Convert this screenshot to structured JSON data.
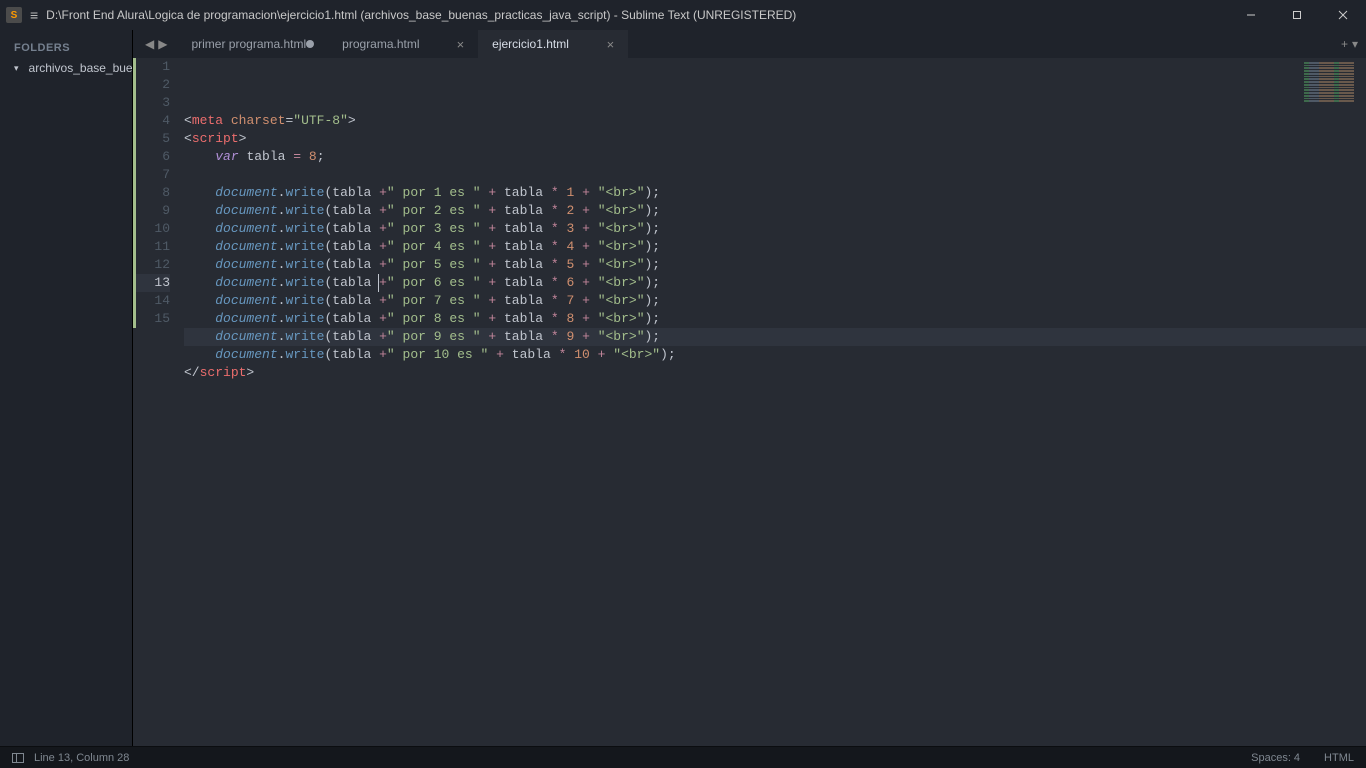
{
  "window": {
    "title": "D:\\Front End Alura\\Logica de programacion\\ejercicio1.html (archivos_base_buenas_practicas_java_script) - Sublime Text (UNREGISTERED)"
  },
  "sidebar": {
    "header": "FOLDERS",
    "root_folder": "archivos_base_buenas_practicas_java_script"
  },
  "tabs": [
    {
      "label": "primer programa.html",
      "dirty": true,
      "active": false
    },
    {
      "label": "programa.html",
      "dirty": false,
      "active": false
    },
    {
      "label": "ejercicio1.html",
      "dirty": false,
      "active": true
    }
  ],
  "editor": {
    "line_count": 15,
    "current_line": 13,
    "lines": [
      {
        "n": 1,
        "tokens": [
          [
            "p",
            "<"
          ],
          [
            "t",
            "meta"
          ],
          [
            "p",
            " "
          ],
          [
            "a",
            "charset"
          ],
          [
            "p",
            "="
          ],
          [
            "s",
            "\"UTF-8\""
          ],
          [
            "p",
            ">"
          ]
        ]
      },
      {
        "n": 2,
        "tokens": [
          [
            "p",
            "<"
          ],
          [
            "t",
            "script"
          ],
          [
            "p",
            ">"
          ]
        ]
      },
      {
        "n": 3,
        "tokens": [
          [
            "p",
            "    "
          ],
          [
            "k",
            "var"
          ],
          [
            "p",
            " "
          ],
          [
            "id",
            "tabla"
          ],
          [
            "p",
            " "
          ],
          [
            "op",
            "="
          ],
          [
            "p",
            " "
          ],
          [
            "n",
            "8"
          ],
          [
            "p",
            ";"
          ]
        ]
      },
      {
        "n": 4,
        "tokens": [
          [
            "p",
            ""
          ]
        ]
      },
      {
        "n": 5,
        "tokens": [
          [
            "p",
            "    "
          ],
          [
            "v",
            "document"
          ],
          [
            "p",
            "."
          ],
          [
            "f",
            "write"
          ],
          [
            "p",
            "("
          ],
          [
            "id",
            "tabla"
          ],
          [
            "p",
            " "
          ],
          [
            "op",
            "+"
          ],
          [
            "s",
            "\" por 1 es \""
          ],
          [
            "p",
            " "
          ],
          [
            "op",
            "+"
          ],
          [
            "p",
            " "
          ],
          [
            "id",
            "tabla"
          ],
          [
            "p",
            " "
          ],
          [
            "op",
            "*"
          ],
          [
            "p",
            " "
          ],
          [
            "n",
            "1"
          ],
          [
            "p",
            " "
          ],
          [
            "op",
            "+"
          ],
          [
            "p",
            " "
          ],
          [
            "s",
            "\"<br>\""
          ],
          [
            "p",
            ");"
          ]
        ]
      },
      {
        "n": 6,
        "tokens": [
          [
            "p",
            "    "
          ],
          [
            "v",
            "document"
          ],
          [
            "p",
            "."
          ],
          [
            "f",
            "write"
          ],
          [
            "p",
            "("
          ],
          [
            "id",
            "tabla"
          ],
          [
            "p",
            " "
          ],
          [
            "op",
            "+"
          ],
          [
            "s",
            "\" por 2 es \""
          ],
          [
            "p",
            " "
          ],
          [
            "op",
            "+"
          ],
          [
            "p",
            " "
          ],
          [
            "id",
            "tabla"
          ],
          [
            "p",
            " "
          ],
          [
            "op",
            "*"
          ],
          [
            "p",
            " "
          ],
          [
            "n",
            "2"
          ],
          [
            "p",
            " "
          ],
          [
            "op",
            "+"
          ],
          [
            "p",
            " "
          ],
          [
            "s",
            "\"<br>\""
          ],
          [
            "p",
            ");"
          ]
        ]
      },
      {
        "n": 7,
        "tokens": [
          [
            "p",
            "    "
          ],
          [
            "v",
            "document"
          ],
          [
            "p",
            "."
          ],
          [
            "f",
            "write"
          ],
          [
            "p",
            "("
          ],
          [
            "id",
            "tabla"
          ],
          [
            "p",
            " "
          ],
          [
            "op",
            "+"
          ],
          [
            "s",
            "\" por 3 es \""
          ],
          [
            "p",
            " "
          ],
          [
            "op",
            "+"
          ],
          [
            "p",
            " "
          ],
          [
            "id",
            "tabla"
          ],
          [
            "p",
            " "
          ],
          [
            "op",
            "*"
          ],
          [
            "p",
            " "
          ],
          [
            "n",
            "3"
          ],
          [
            "p",
            " "
          ],
          [
            "op",
            "+"
          ],
          [
            "p",
            " "
          ],
          [
            "s",
            "\"<br>\""
          ],
          [
            "p",
            ");"
          ]
        ]
      },
      {
        "n": 8,
        "tokens": [
          [
            "p",
            "    "
          ],
          [
            "v",
            "document"
          ],
          [
            "p",
            "."
          ],
          [
            "f",
            "write"
          ],
          [
            "p",
            "("
          ],
          [
            "id",
            "tabla"
          ],
          [
            "p",
            " "
          ],
          [
            "op",
            "+"
          ],
          [
            "s",
            "\" por 4 es \""
          ],
          [
            "p",
            " "
          ],
          [
            "op",
            "+"
          ],
          [
            "p",
            " "
          ],
          [
            "id",
            "tabla"
          ],
          [
            "p",
            " "
          ],
          [
            "op",
            "*"
          ],
          [
            "p",
            " "
          ],
          [
            "n",
            "4"
          ],
          [
            "p",
            " "
          ],
          [
            "op",
            "+"
          ],
          [
            "p",
            " "
          ],
          [
            "s",
            "\"<br>\""
          ],
          [
            "p",
            ");"
          ]
        ]
      },
      {
        "n": 9,
        "tokens": [
          [
            "p",
            "    "
          ],
          [
            "v",
            "document"
          ],
          [
            "p",
            "."
          ],
          [
            "f",
            "write"
          ],
          [
            "p",
            "("
          ],
          [
            "id",
            "tabla"
          ],
          [
            "p",
            " "
          ],
          [
            "op",
            "+"
          ],
          [
            "s",
            "\" por 5 es \""
          ],
          [
            "p",
            " "
          ],
          [
            "op",
            "+"
          ],
          [
            "p",
            " "
          ],
          [
            "id",
            "tabla"
          ],
          [
            "p",
            " "
          ],
          [
            "op",
            "*"
          ],
          [
            "p",
            " "
          ],
          [
            "n",
            "5"
          ],
          [
            "p",
            " "
          ],
          [
            "op",
            "+"
          ],
          [
            "p",
            " "
          ],
          [
            "s",
            "\"<br>\""
          ],
          [
            "p",
            ");"
          ]
        ]
      },
      {
        "n": 10,
        "tokens": [
          [
            "p",
            "    "
          ],
          [
            "v",
            "document"
          ],
          [
            "p",
            "."
          ],
          [
            "f",
            "write"
          ],
          [
            "p",
            "("
          ],
          [
            "id",
            "tabla"
          ],
          [
            "p",
            " "
          ],
          [
            "op",
            "+"
          ],
          [
            "s",
            "\" por 6 es \""
          ],
          [
            "p",
            " "
          ],
          [
            "op",
            "+"
          ],
          [
            "p",
            " "
          ],
          [
            "id",
            "tabla"
          ],
          [
            "p",
            " "
          ],
          [
            "op",
            "*"
          ],
          [
            "p",
            " "
          ],
          [
            "n",
            "6"
          ],
          [
            "p",
            " "
          ],
          [
            "op",
            "+"
          ],
          [
            "p",
            " "
          ],
          [
            "s",
            "\"<br>\""
          ],
          [
            "p",
            ");"
          ]
        ]
      },
      {
        "n": 11,
        "tokens": [
          [
            "p",
            "    "
          ],
          [
            "v",
            "document"
          ],
          [
            "p",
            "."
          ],
          [
            "f",
            "write"
          ],
          [
            "p",
            "("
          ],
          [
            "id",
            "tabla"
          ],
          [
            "p",
            " "
          ],
          [
            "op",
            "+"
          ],
          [
            "s",
            "\" por 7 es \""
          ],
          [
            "p",
            " "
          ],
          [
            "op",
            "+"
          ],
          [
            "p",
            " "
          ],
          [
            "id",
            "tabla"
          ],
          [
            "p",
            " "
          ],
          [
            "op",
            "*"
          ],
          [
            "p",
            " "
          ],
          [
            "n",
            "7"
          ],
          [
            "p",
            " "
          ],
          [
            "op",
            "+"
          ],
          [
            "p",
            " "
          ],
          [
            "s",
            "\"<br>\""
          ],
          [
            "p",
            ");"
          ]
        ]
      },
      {
        "n": 12,
        "tokens": [
          [
            "p",
            "    "
          ],
          [
            "v",
            "document"
          ],
          [
            "p",
            "."
          ],
          [
            "f",
            "write"
          ],
          [
            "p",
            "("
          ],
          [
            "id",
            "tabla"
          ],
          [
            "p",
            " "
          ],
          [
            "op",
            "+"
          ],
          [
            "s",
            "\" por 8 es \""
          ],
          [
            "p",
            " "
          ],
          [
            "op",
            "+"
          ],
          [
            "p",
            " "
          ],
          [
            "id",
            "tabla"
          ],
          [
            "p",
            " "
          ],
          [
            "op",
            "*"
          ],
          [
            "p",
            " "
          ],
          [
            "n",
            "8"
          ],
          [
            "p",
            " "
          ],
          [
            "op",
            "+"
          ],
          [
            "p",
            " "
          ],
          [
            "s",
            "\"<br>\""
          ],
          [
            "p",
            ");"
          ]
        ]
      },
      {
        "n": 13,
        "tokens": [
          [
            "p",
            "    "
          ],
          [
            "v",
            "document"
          ],
          [
            "p",
            "."
          ],
          [
            "f",
            "write"
          ],
          [
            "p",
            "("
          ],
          [
            "id",
            "tabla"
          ],
          [
            "p",
            " "
          ],
          [
            "op",
            "+"
          ],
          [
            "s",
            "\" por 9 es \""
          ],
          [
            "p",
            " "
          ],
          [
            "op",
            "+"
          ],
          [
            "p",
            " "
          ],
          [
            "id",
            "tabla"
          ],
          [
            "p",
            " "
          ],
          [
            "op",
            "*"
          ],
          [
            "p",
            " "
          ],
          [
            "n",
            "9"
          ],
          [
            "p",
            " "
          ],
          [
            "op",
            "+"
          ],
          [
            "p",
            " "
          ],
          [
            "s",
            "\"<br>\""
          ],
          [
            "p",
            ");"
          ]
        ]
      },
      {
        "n": 14,
        "tokens": [
          [
            "p",
            "    "
          ],
          [
            "v",
            "document"
          ],
          [
            "p",
            "."
          ],
          [
            "f",
            "write"
          ],
          [
            "p",
            "("
          ],
          [
            "id",
            "tabla"
          ],
          [
            "p",
            " "
          ],
          [
            "op",
            "+"
          ],
          [
            "s",
            "\" por 10 es \""
          ],
          [
            "p",
            " "
          ],
          [
            "op",
            "+"
          ],
          [
            "p",
            " "
          ],
          [
            "id",
            "tabla"
          ],
          [
            "p",
            " "
          ],
          [
            "op",
            "*"
          ],
          [
            "p",
            " "
          ],
          [
            "n",
            "10"
          ],
          [
            "p",
            " "
          ],
          [
            "op",
            "+"
          ],
          [
            "p",
            " "
          ],
          [
            "s",
            "\"<br>\""
          ],
          [
            "p",
            ");"
          ]
        ]
      },
      {
        "n": 15,
        "tokens": [
          [
            "p",
            "</"
          ],
          [
            "t",
            "script"
          ],
          [
            "p",
            ">"
          ]
        ]
      }
    ]
  },
  "status": {
    "pos": "Line 13, Column 28",
    "spaces": "Spaces: 4",
    "syntax": "HTML"
  }
}
